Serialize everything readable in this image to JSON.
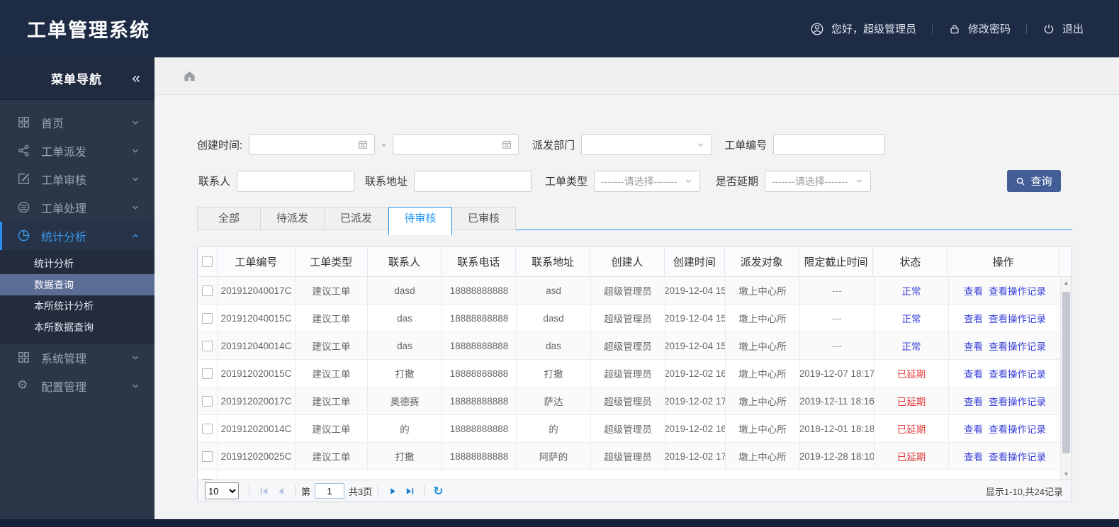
{
  "app": {
    "title": "工单管理系统"
  },
  "header": {
    "greeting": "您好，超级管理员",
    "change_password": "修改密码",
    "logout": "退出"
  },
  "sidebar": {
    "title": "菜单导航",
    "collapse_icon": "«",
    "items": [
      {
        "name": "home",
        "label": "首页",
        "icon": "grid-icon",
        "state": "collapsed"
      },
      {
        "name": "dispatch",
        "label": "工单派发",
        "icon": "share-icon",
        "state": "collapsed"
      },
      {
        "name": "review",
        "label": "工单审核",
        "icon": "edit-icon",
        "state": "collapsed"
      },
      {
        "name": "process",
        "label": "工单处理",
        "icon": "process-icon",
        "state": "collapsed"
      },
      {
        "name": "stats",
        "label": "统计分析",
        "icon": "pie-icon",
        "state": "expanded",
        "active": true,
        "children": [
          {
            "name": "stats-analysis",
            "label": "统计分析",
            "selected": false
          },
          {
            "name": "data-query",
            "label": "数据查询",
            "selected": true
          },
          {
            "name": "station-stats",
            "label": "本所统计分析",
            "selected": false
          },
          {
            "name": "station-data-query",
            "label": "本所数据查询",
            "selected": false
          }
        ]
      },
      {
        "name": "system",
        "label": "系统管理",
        "icon": "apps-icon",
        "state": "collapsed"
      },
      {
        "name": "config",
        "label": "配置管理",
        "icon": "gear-icon",
        "state": "collapsed"
      }
    ]
  },
  "filters": {
    "create_time_label": "创建时间:",
    "range_separator": "-",
    "dispatch_dept_label": "派发部门",
    "order_no_label": "工单编号",
    "contact_label": "联系人",
    "address_label": "联系地址",
    "order_type_label": "工单类型",
    "order_type_value": "-------请选择-------",
    "delay_label": "是否延期",
    "delay_value": "-------请选择-------",
    "search_button": "查询"
  },
  "tabs": [
    {
      "name": "all",
      "label": "全部",
      "active": false
    },
    {
      "name": "pending-dispatch",
      "label": "待派发",
      "active": false
    },
    {
      "name": "dispatched",
      "label": "已派发",
      "active": false
    },
    {
      "name": "pending-review",
      "label": "待审核",
      "active": true
    },
    {
      "name": "reviewed",
      "label": "已审核",
      "active": false
    }
  ],
  "table": {
    "columns": [
      "工单编号",
      "工单类型",
      "联系人",
      "联系电话",
      "联系地址",
      "创建人",
      "创建时间",
      "派发对象",
      "限定截止时间",
      "状态",
      "操作"
    ],
    "actions": [
      "查看",
      "查看操作记录"
    ],
    "status_colors": {
      "正常": "#3a41d8",
      "已延期": "#e03a3a"
    },
    "rows": [
      {
        "order_no": "201912040017C",
        "type": "建议工单",
        "contact": "dasd",
        "phone": "18888888888",
        "address": "asd",
        "creator": "超级管理员",
        "created": "2019-12-04 15",
        "target": "墩上中心所",
        "deadline": "---",
        "status": "正常"
      },
      {
        "order_no": "201912040015C",
        "type": "建议工单",
        "contact": "das",
        "phone": "18888888888",
        "address": "dasd",
        "creator": "超级管理员",
        "created": "2019-12-04 15",
        "target": "墩上中心所",
        "deadline": "---",
        "status": "正常"
      },
      {
        "order_no": "201912040014C",
        "type": "建议工单",
        "contact": "das",
        "phone": "18888888888",
        "address": "das",
        "creator": "超级管理员",
        "created": "2019-12-04 15",
        "target": "墩上中心所",
        "deadline": "---",
        "status": "正常"
      },
      {
        "order_no": "201912020015C",
        "type": "建议工单",
        "contact": "打撒",
        "phone": "18888888888",
        "address": "打撒",
        "creator": "超级管理员",
        "created": "2019-12-02 16",
        "target": "墩上中心所",
        "deadline": "2019-12-07 18:17",
        "status": "已延期"
      },
      {
        "order_no": "201912020017C",
        "type": "建议工单",
        "contact": "奥德赛",
        "phone": "18888888888",
        "address": "萨达",
        "creator": "超级管理员",
        "created": "2019-12-02 17",
        "target": "墩上中心所",
        "deadline": "2019-12-11 18:16",
        "status": "已延期"
      },
      {
        "order_no": "201912020014C",
        "type": "建议工单",
        "contact": "的",
        "phone": "18888888888",
        "address": "的",
        "creator": "超级管理员",
        "created": "2019-12-02 16",
        "target": "墩上中心所",
        "deadline": "2018-12-01 18:18",
        "status": "已延期"
      },
      {
        "order_no": "201912020025C",
        "type": "建议工单",
        "contact": "打撒",
        "phone": "18888888888",
        "address": "阿萨的",
        "creator": "超级管理员",
        "created": "2019-12-02 17",
        "target": "墩上中心所",
        "deadline": "2019-12-28 18:10",
        "status": "已延期"
      }
    ]
  },
  "pagination": {
    "page_size": "10",
    "page_prefix": "第",
    "current_page": "1",
    "total_pages_label": "共3页",
    "summary": "显示1-10,共24记录"
  }
}
